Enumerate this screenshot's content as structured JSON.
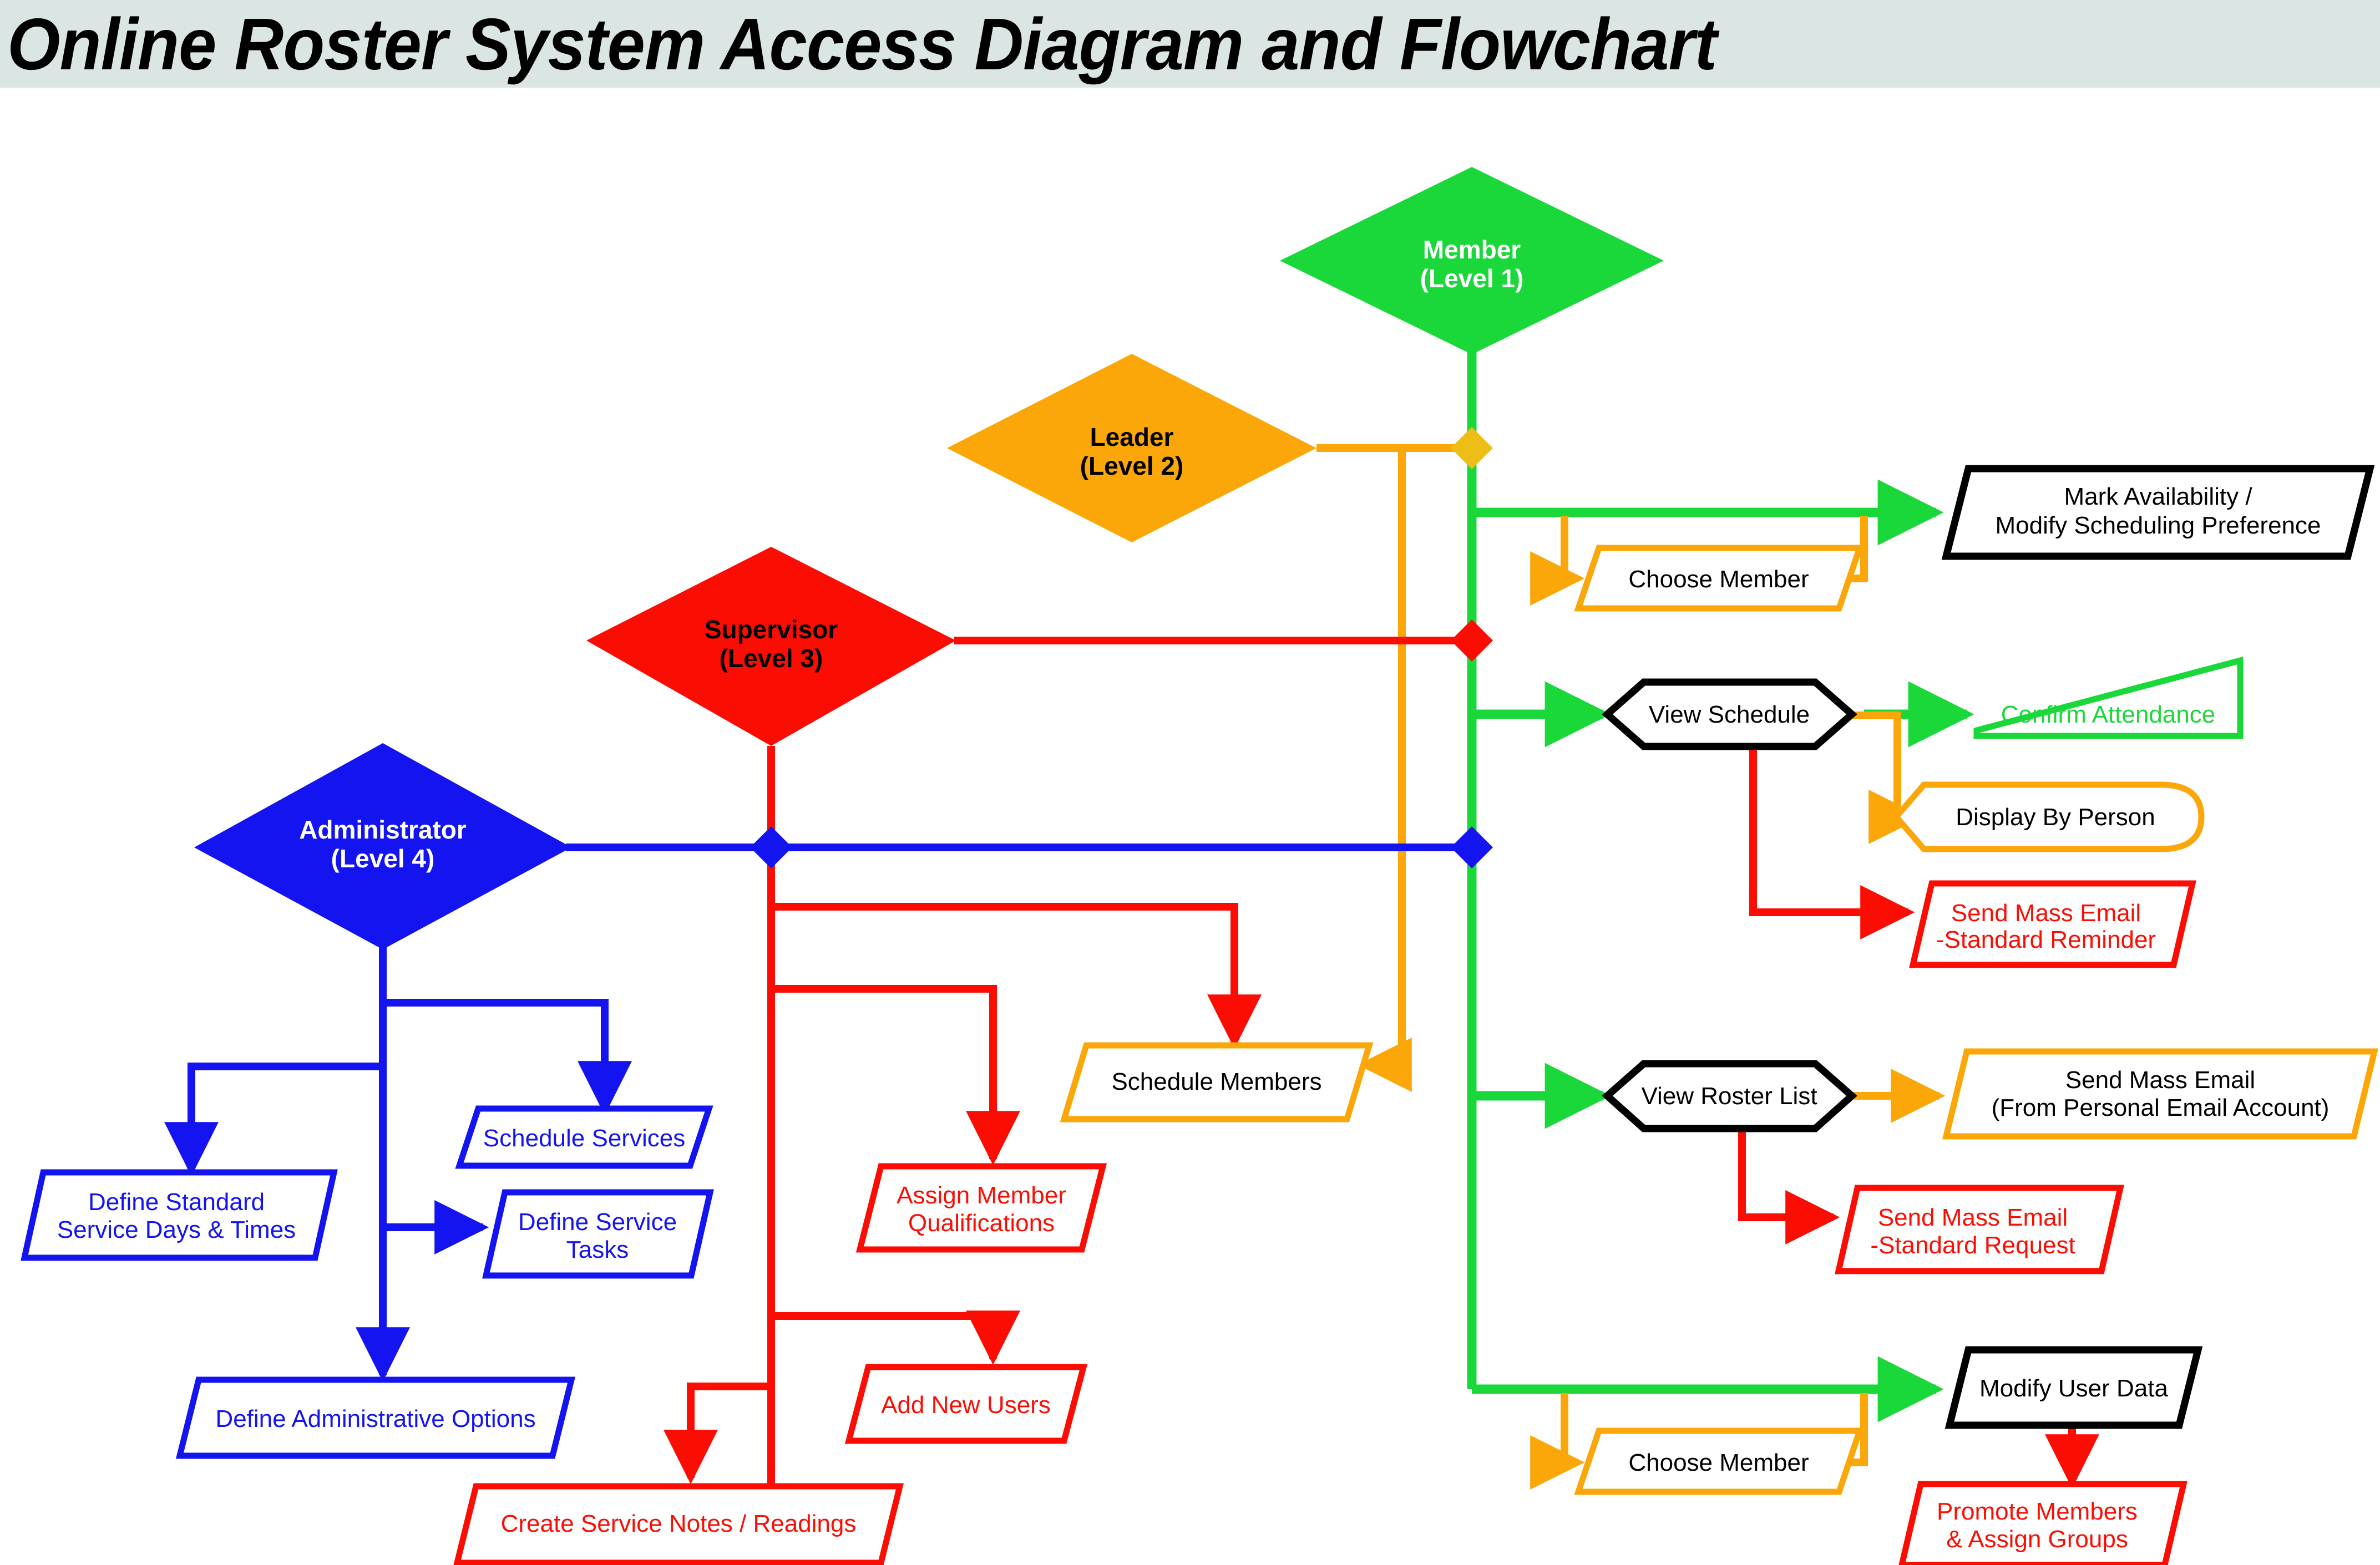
{
  "title": "Online Roster System Access Diagram and Flowchart",
  "colors": {
    "member_green": "#1BD83A",
    "leader_orange": "#FBA70A",
    "supervisor_red": "#FC0D04",
    "administrator_blue": "#1414F0",
    "black": "#000000",
    "title_bar": "#dbe5e3"
  },
  "roles": [
    {
      "id": "member",
      "name": "Member",
      "level": "(Level 1)",
      "color": "#1BD83A",
      "text_color": "#ffffff"
    },
    {
      "id": "leader",
      "name": "Leader",
      "level": "(Level 2)",
      "color": "#FBA70A",
      "text_color": "#000000"
    },
    {
      "id": "supervisor",
      "name": "Supervisor",
      "level": "(Level 3)",
      "color": "#FC0D04",
      "text_color": "#000000"
    },
    {
      "id": "administrator",
      "name": "Administrator",
      "level": "(Level 4)",
      "color": "#1414F0",
      "text_color": "#ffffff"
    }
  ],
  "nodes": {
    "mark_availability": {
      "line1": "Mark Availability /",
      "line2": "Modify Scheduling Preference",
      "shape": "parallelogram",
      "color": "#000000"
    },
    "choose_member_top": {
      "line1": "Choose Member",
      "shape": "parallelogram",
      "color": "#FBA70A"
    },
    "view_schedule": {
      "line1": "View Schedule",
      "shape": "hexagon",
      "color": "#000000"
    },
    "confirm_attendance": {
      "line1": "Confirm Attendance",
      "shape": "trapezoid",
      "color": "#1BD83A"
    },
    "display_by_person": {
      "line1": "Display By Person",
      "shape": "stadium",
      "color": "#FBA70A"
    },
    "send_mass_reminder": {
      "line1": "Send Mass Email",
      "line2": "-Standard Reminder",
      "shape": "parallelogram",
      "color": "#FC0D04"
    },
    "view_roster_list": {
      "line1": "View Roster List",
      "shape": "hexagon",
      "color": "#000000"
    },
    "send_mass_personal": {
      "line1": "Send Mass Email",
      "line2": "(From Personal Email Account)",
      "shape": "parallelogram",
      "color": "#FBA70A"
    },
    "send_mass_request": {
      "line1": "Send Mass Email",
      "line2": "-Standard Request",
      "shape": "parallelogram",
      "color": "#FC0D04"
    },
    "modify_user_data": {
      "line1": "Modify User Data",
      "shape": "parallelogram",
      "color": "#000000"
    },
    "choose_member_bottom": {
      "line1": "Choose Member",
      "shape": "parallelogram",
      "color": "#FBA70A"
    },
    "promote_members": {
      "line1": "Promote Members",
      "line2": "& Assign Groups",
      "shape": "parallelogram",
      "color": "#FC0D04"
    },
    "schedule_members": {
      "line1": "Schedule Members",
      "shape": "parallelogram",
      "color": "#FBA70A"
    },
    "assign_qualifications": {
      "line1": "Assign Member",
      "line2": "Qualifications",
      "shape": "parallelogram",
      "color": "#FC0D04"
    },
    "add_new_users": {
      "line1": "Add New Users",
      "shape": "parallelogram",
      "color": "#FC0D04"
    },
    "create_service_notes": {
      "line1": "Create Service Notes / Readings",
      "shape": "parallelogram",
      "color": "#FC0D04"
    },
    "schedule_services": {
      "line1": "Schedule Services",
      "shape": "parallelogram",
      "color": "#1414F0"
    },
    "define_standard_days": {
      "line1": "Define Standard",
      "line2": "Service Days & Times",
      "shape": "parallelogram",
      "color": "#1414F0"
    },
    "define_service_tasks": {
      "line1": "Define Service",
      "line2": "Tasks",
      "shape": "parallelogram",
      "color": "#1414F0"
    },
    "define_admin_options": {
      "line1": "Define Administrative Options",
      "shape": "parallelogram",
      "color": "#1414F0"
    }
  }
}
